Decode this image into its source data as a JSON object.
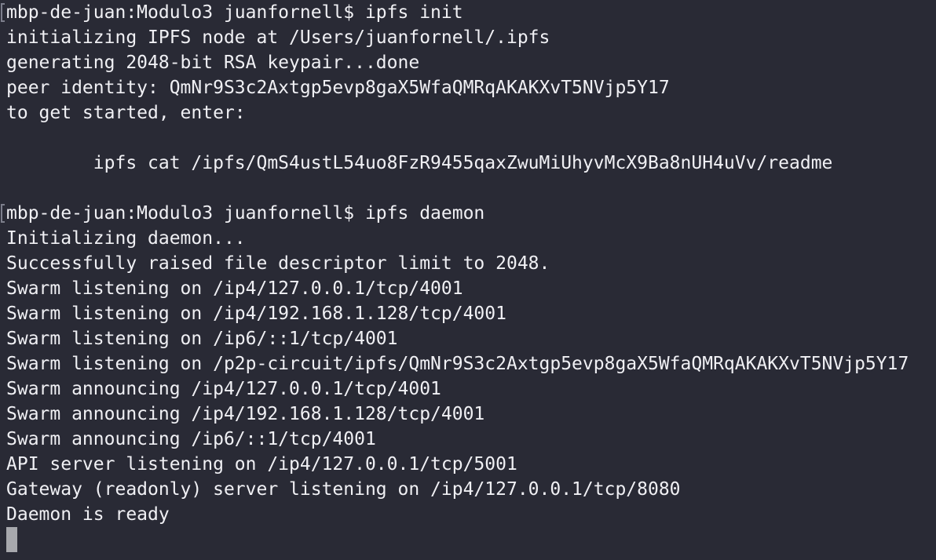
{
  "terminal": {
    "background": "#292a35",
    "foreground": "#f0f0f4",
    "cursor_color": "#a7a8ad",
    "lines": [
      "mbp-de-juan:Modulo3 juanfornell$ ipfs init",
      "initializing IPFS node at /Users/juanfornell/.ipfs",
      "generating 2048-bit RSA keypair...done",
      "peer identity: QmNr9S3c2Axtgp5evp8gaX5WfaQMRqAKAKXvT5NVjp5Y17",
      "to get started, enter:",
      "",
      "        ipfs cat /ipfs/QmS4ustL54uo8FzR9455qaxZwuMiUhyvMcX9Ba8nUH4uVv/readme",
      "",
      "mbp-de-juan:Modulo3 juanfornell$ ipfs daemon",
      "Initializing daemon...",
      "Successfully raised file descriptor limit to 2048.",
      "Swarm listening on /ip4/127.0.0.1/tcp/4001",
      "Swarm listening on /ip4/192.168.1.128/tcp/4001",
      "Swarm listening on /ip6/::1/tcp/4001",
      "Swarm listening on /p2p-circuit/ipfs/QmNr9S3c2Axtgp5evp8gaX5WfaQMRqAKAKXvT5NVjp5Y17",
      "Swarm announcing /ip4/127.0.0.1/tcp/4001",
      "Swarm announcing /ip4/192.168.1.128/tcp/4001",
      "Swarm announcing /ip6/::1/tcp/4001",
      "API server listening on /ip4/127.0.0.1/tcp/5001",
      "Gateway (readonly) server listening on /ip4/127.0.0.1/tcp/8080",
      "Daemon is ready"
    ]
  }
}
